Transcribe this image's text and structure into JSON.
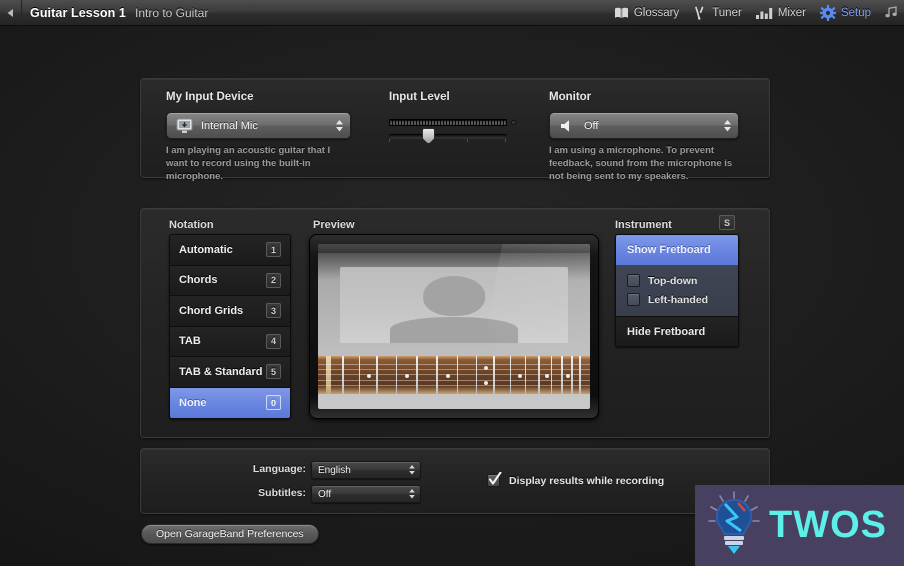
{
  "topbar": {
    "back_icon": "back-arrow-icon",
    "lesson_title": "Guitar Lesson 1",
    "lesson_subtitle": "Intro to Guitar",
    "items": [
      {
        "label": "Glossary",
        "icon": "book-icon",
        "active": false
      },
      {
        "label": "Tuner",
        "icon": "tuning-fork-icon",
        "active": false
      },
      {
        "label": "Mixer",
        "icon": "mixer-bars-icon",
        "active": false
      },
      {
        "label": "Setup",
        "icon": "gear-icon",
        "active": true
      }
    ],
    "trailing_icon": "music-note-icon",
    "active_color": "#7d9bf0"
  },
  "devices": {
    "input_device": {
      "label": "My Input Device",
      "icon": "display-input-icon",
      "value": "Internal Mic",
      "help": "I am playing an acoustic guitar that I want to record using the built-in microphone."
    },
    "input_level": {
      "label": "Input Level",
      "meter_icon": "clip-led-icon",
      "slider_value": 33
    },
    "monitor": {
      "label": "Monitor",
      "icon": "speaker-icon",
      "value": "Off",
      "help": "I am using a microphone. To prevent feedback, sound from the microphone is not being sent to my speakers."
    }
  },
  "notation": {
    "heading": "Notation",
    "items": [
      {
        "label": "Automatic",
        "key": "1",
        "selected": false
      },
      {
        "label": "Chords",
        "key": "2",
        "selected": false
      },
      {
        "label": "Chord Grids",
        "key": "3",
        "selected": false
      },
      {
        "label": "TAB",
        "key": "4",
        "selected": false
      },
      {
        "label": "TAB & Standard",
        "key": "5",
        "selected": false
      },
      {
        "label": "None",
        "key": "0",
        "selected": true
      }
    ],
    "selected_color": "#6a86e0"
  },
  "preview": {
    "heading": "Preview",
    "screen_icon": "teacher-video-preview"
  },
  "instrument": {
    "heading": "Instrument",
    "shortcut_badge": "S",
    "show_fretboard": "Show Fretboard",
    "options": [
      {
        "label": "Top-down",
        "checked": false
      },
      {
        "label": "Left-handed",
        "checked": false
      }
    ],
    "hide_fretboard": "Hide Fretboard"
  },
  "language_section": {
    "language_label": "Language:",
    "language_value": "English",
    "subtitles_label": "Subtitles:",
    "subtitles_value": "Off",
    "display_results_label": "Display results while recording",
    "display_results_checked": true
  },
  "footer": {
    "preferences_button": "Open GarageBand Preferences"
  },
  "watermark": {
    "text": "TWOS",
    "logo_icon": "lightbulb-icon",
    "bg_color": "#474061",
    "text_color": "#5df0e8"
  }
}
